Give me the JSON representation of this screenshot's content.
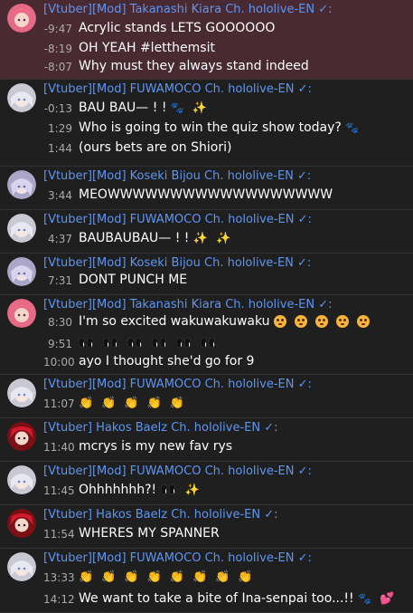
{
  "messages": [
    {
      "author": "[Vtuber][Mod] Takanashi Kiara Ch. hololive-EN ✓:",
      "avatar": "kiara",
      "highlight": true,
      "lines": [
        {
          "ts": "-9:47",
          "text": "Acrylic stands LETS GOOOOOO",
          "emoji": []
        },
        {
          "ts": "-8:19",
          "text": "OH YEAH #letthemsit",
          "emoji": []
        },
        {
          "ts": "-8:07",
          "text": "Why must they always stand indeed",
          "emoji": []
        }
      ]
    },
    {
      "author": "[Vtuber][Mod] FUWAMOCO Ch. hololive-EN ✓:",
      "avatar": "fuwamoco",
      "lines": [
        {
          "ts": "-0:13",
          "text": "BAU BAU— ! !",
          "emoji": [
            "paw-emoji",
            "sparkle-emoji"
          ]
        },
        {
          "ts": "1:29",
          "text": "Who is going to win the quiz show today?",
          "emoji": [
            "paw-emoji"
          ]
        },
        {
          "ts": "1:44",
          "text": "(ours bets are on Shiori)",
          "emoji": []
        }
      ]
    },
    {
      "author": "[Vtuber][Mod] Koseki Bijou Ch. hololive-EN ✓:",
      "avatar": "bijou",
      "lines": [
        {
          "ts": "3:44",
          "text": "MEOWWWWWWWWWWWWWWWWWW",
          "emoji": []
        }
      ]
    },
    {
      "author": "[Vtuber][Mod] FUWAMOCO Ch. hololive-EN ✓:",
      "avatar": "fuwamoco",
      "lines": [
        {
          "ts": "4:37",
          "text": "BAUBAUBAU— ! !",
          "emoji": [
            "sparkle-emoji",
            "sparkle-emoji"
          ]
        }
      ]
    },
    {
      "author": "[Vtuber][Mod] Koseki Bijou Ch. hololive-EN ✓:",
      "avatar": "bijou",
      "lines": [
        {
          "ts": "7:31",
          "text": "DONT PUNCH ME",
          "emoji": []
        }
      ]
    },
    {
      "author": "[Vtuber][Mod] Takanashi Kiara Ch. hololive-EN ✓:",
      "avatar": "kiara",
      "lines": [
        {
          "ts": "8:30",
          "text": "I'm so excited wakuwakuwaku",
          "emoji": [
            "face-emoji",
            "face-emoji",
            "face-emoji",
            "face-emoji",
            "face-emoji"
          ]
        },
        {
          "ts": "9:51",
          "text": "",
          "emoji": [
            "eyes-emoji",
            "eyes-emoji",
            "eyes-emoji",
            "eyes-emoji",
            "eyes-emoji",
            "eyes-emoji"
          ]
        },
        {
          "ts": "10:00",
          "text": "ayo I thought she'd go for 9",
          "emoji": []
        }
      ]
    },
    {
      "author": "[Vtuber][Mod] FUWAMOCO Ch. hololive-EN ✓:",
      "avatar": "fuwamoco",
      "lines": [
        {
          "ts": "11:07",
          "text": "",
          "emoji": [
            "clap-emoji",
            "clap-emoji",
            "clap-emoji",
            "clap-emoji",
            "clap-emoji"
          ]
        }
      ]
    },
    {
      "author": "[Vtuber] Hakos Baelz Ch. hololive-EN ✓:",
      "avatar": "baelz",
      "lines": [
        {
          "ts": "11:40",
          "text": "mcrys is my new fav rys",
          "emoji": []
        }
      ]
    },
    {
      "author": "[Vtuber][Mod] FUWAMOCO Ch. hololive-EN ✓:",
      "avatar": "fuwamoco",
      "lines": [
        {
          "ts": "11:45",
          "text": "Ohhhhhhh?!",
          "emoji": [
            "eyes-emoji",
            "sparkle-emoji"
          ]
        }
      ]
    },
    {
      "author": "[Vtuber] Hakos Baelz Ch. hololive-EN ✓:",
      "avatar": "baelz",
      "lines": [
        {
          "ts": "11:54",
          "text": "WHERES MY SPANNER",
          "emoji": []
        }
      ]
    },
    {
      "author": "[Vtuber][Mod] FUWAMOCO Ch. hololive-EN ✓:",
      "avatar": "fuwamoco",
      "lines": [
        {
          "ts": "13:33",
          "text": "",
          "emoji": [
            "clap-emoji",
            "clap-emoji",
            "clap-emoji",
            "clap-emoji",
            "clap-emoji",
            "clap-emoji",
            "clap-emoji",
            "clap-emoji"
          ]
        },
        {
          "ts": "14:12",
          "text": "We want to take a bite of Ina-senpai too...!!",
          "emoji": [
            "paw-emoji",
            "heart-emoji"
          ]
        }
      ]
    }
  ],
  "colors": {
    "background": "#1f1f1f",
    "highlight": "#4a2a32",
    "author": "#5d95f0",
    "timestamp": "#aaaaaa",
    "text": "#ffffff"
  }
}
